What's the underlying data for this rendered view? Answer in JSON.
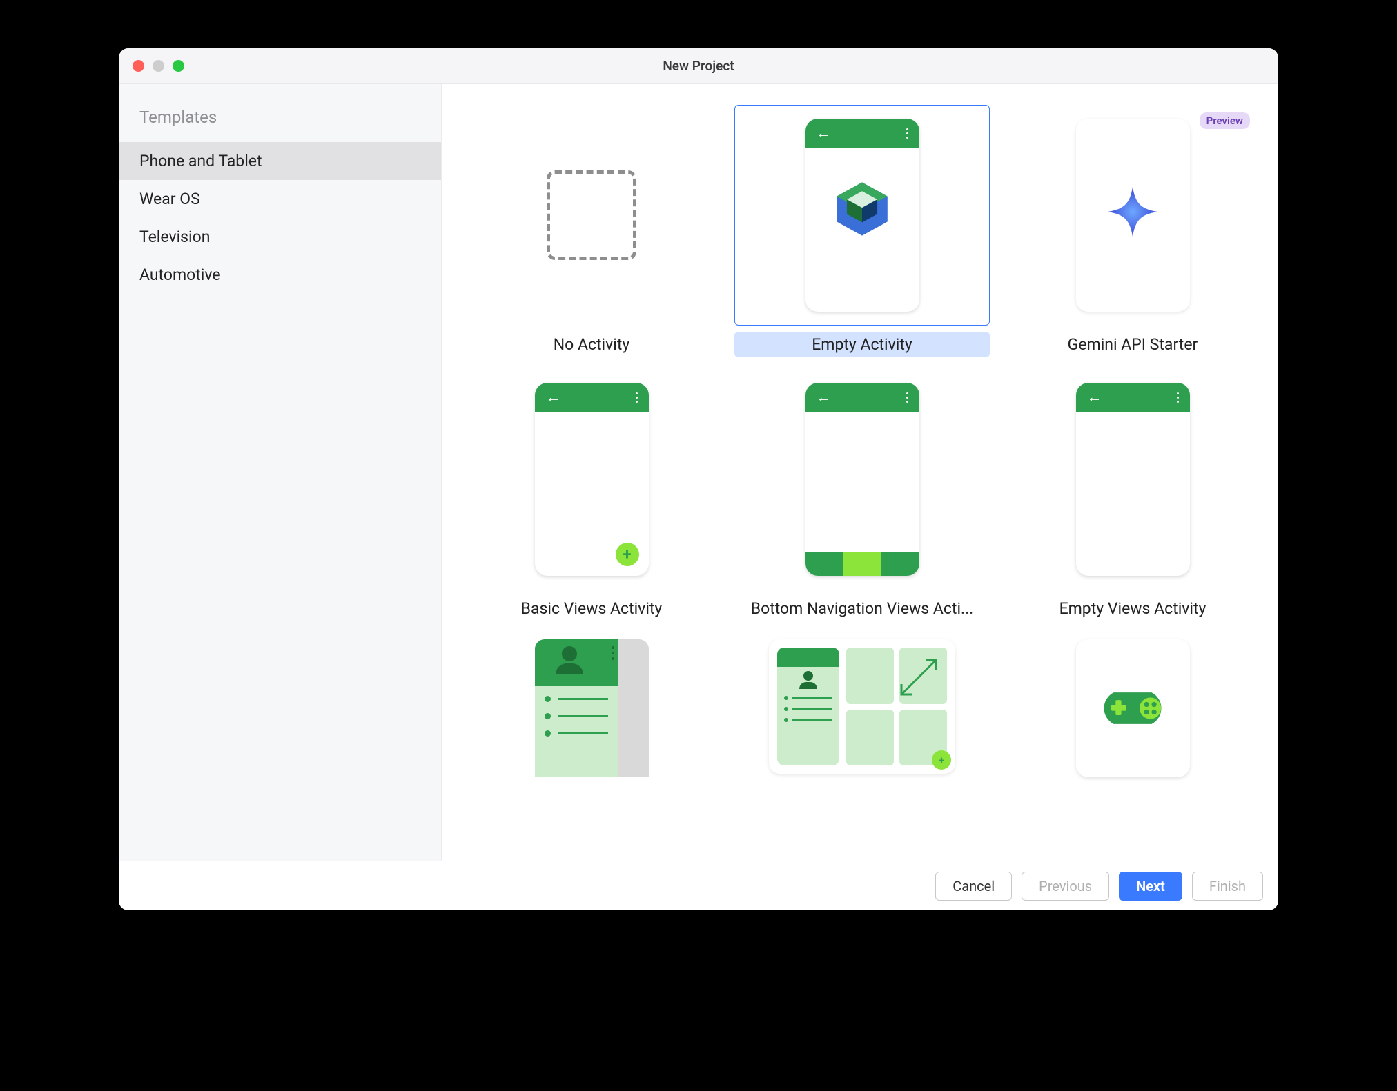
{
  "window": {
    "title": "New Project"
  },
  "sidebar": {
    "header": "Templates",
    "items": [
      {
        "label": "Phone and Tablet",
        "selected": true
      },
      {
        "label": "Wear OS",
        "selected": false
      },
      {
        "label": "Television",
        "selected": false
      },
      {
        "label": "Automotive",
        "selected": false
      }
    ]
  },
  "templates": [
    {
      "id": "no-activity",
      "label": "No Activity",
      "kind": "dashed",
      "selected": false,
      "badge": null
    },
    {
      "id": "empty-activity",
      "label": "Empty Activity",
      "kind": "phone-logo",
      "selected": true,
      "badge": null
    },
    {
      "id": "gemini-api-starter",
      "label": "Gemini API Starter",
      "kind": "phone-sparkle",
      "selected": false,
      "badge": "Preview"
    },
    {
      "id": "basic-views-activity",
      "label": "Basic Views Activity",
      "kind": "phone-fab",
      "selected": false,
      "badge": null
    },
    {
      "id": "bottom-nav-views",
      "label": "Bottom Navigation Views Acti...",
      "kind": "phone-bottomnav",
      "selected": false,
      "badge": null
    },
    {
      "id": "empty-views-activity",
      "label": "Empty Views Activity",
      "kind": "phone-plain",
      "selected": false,
      "badge": null
    },
    {
      "id": "nav-drawer-views",
      "label": "",
      "kind": "drawer",
      "selected": false,
      "badge": null
    },
    {
      "id": "responsive-views",
      "label": "",
      "kind": "responsive",
      "selected": false,
      "badge": null
    },
    {
      "id": "game-activity",
      "label": "",
      "kind": "game",
      "selected": false,
      "badge": null
    }
  ],
  "footer": {
    "cancel": "Cancel",
    "previous": "Previous",
    "next": "Next",
    "finish": "Finish"
  }
}
